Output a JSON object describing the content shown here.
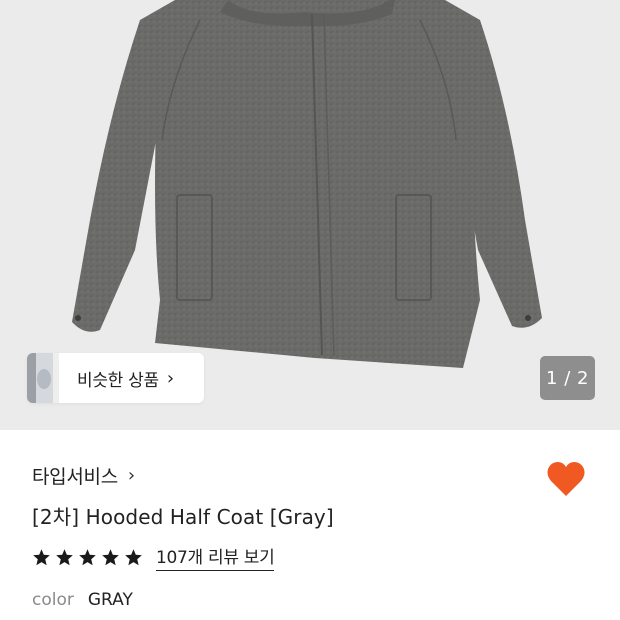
{
  "gallery": {
    "image_name": "gray-hooded-half-coat",
    "pager": "1 / 2",
    "similar_label": "비슷한 상품"
  },
  "product": {
    "brand": "타입서비스",
    "title": "[2차] Hooded Half Coat [Gray]",
    "rating_stars": 5,
    "review_link": "107개 리뷰 보기",
    "option_label": "color",
    "option_value": "GRAY"
  },
  "colors": {
    "heart": "#f05a22",
    "star": "#1a1a1a",
    "pager_bg": "#8e8e8e",
    "hero_bg": "#ebebeb"
  }
}
